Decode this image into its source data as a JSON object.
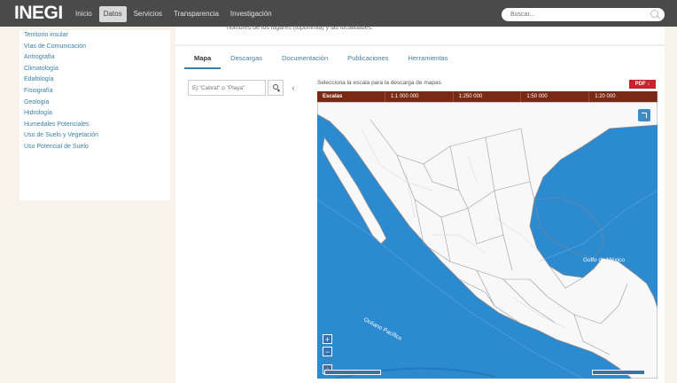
{
  "header": {
    "logo": "INEGI",
    "nav": [
      "Inicio",
      "Datos",
      "Servicios",
      "Transparencia",
      "Investigación"
    ],
    "active_nav": "Datos",
    "search_placeholder": "Buscar..."
  },
  "sidebar": {
    "items": [
      "Territorio insular",
      "Vías de Comunicación",
      "Antrografía",
      "Climatología",
      "Edafología",
      "Fisiografía",
      "Geología",
      "Hidrología",
      "Humedales Potenciales",
      "Uso de Suelo y Vegetación",
      "Uso Potencial de Suelo"
    ]
  },
  "main": {
    "intro_text": "nombres de los lugares (toponimia) y las localidades.",
    "tabs": [
      "Mapa",
      "Descargas",
      "Documentación",
      "Publicaciones",
      "Herramientas"
    ],
    "active_tab": "Mapa",
    "search_placeholder": "Ej:\"Cabral\" o \"Playa\"",
    "collapse_label": "‹"
  },
  "map": {
    "title": "Selecciona la escala para la descarga de mapas",
    "pdf_label": "PDF ↓",
    "scales": [
      "Escalas",
      "1:1 000 000",
      "1:250 000",
      "1:50 000",
      "1:20 000"
    ],
    "zoom_in": "+",
    "zoom_out": "−",
    "home": "⌂",
    "labels": {
      "gulf": "Golfo de México",
      "pacific": "Océano Pacífico"
    },
    "colors": {
      "land": "#f8f8f8",
      "ocean": "#2b8ad0",
      "border": "#777777",
      "scale_bar": "#7a2a14",
      "accent": "#3e7fa8"
    }
  }
}
